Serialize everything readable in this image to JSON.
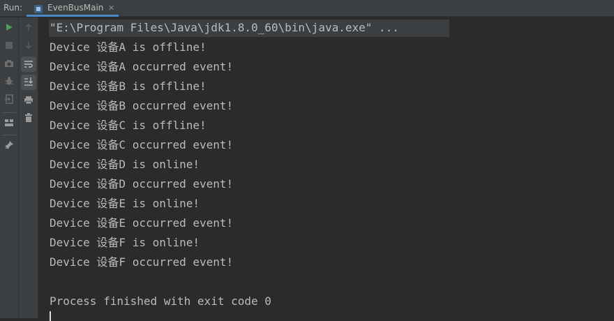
{
  "header": {
    "run_label": "Run:",
    "tab_label": "EvenBusMain",
    "tab_close": "✕"
  },
  "toolbar": {
    "left": [
      "run-icon",
      "stop-icon",
      "camera-icon",
      "debug-icon",
      "exit-icon",
      "layout-icon",
      "pin-icon"
    ],
    "right": [
      "up-arrow-icon",
      "down-arrow-icon",
      "soft-wrap-icon",
      "scroll-to-end-icon",
      "print-icon",
      "trash-icon"
    ]
  },
  "console": {
    "command": "\"E:\\Program Files\\Java\\jdk1.8.0_60\\bin\\java.exe\" ...",
    "lines": [
      "Device 设备A is offline!",
      "Device 设备A occurred event!",
      "Device 设备B is offline!",
      "Device 设备B occurred event!",
      "Device 设备C is offline!",
      "Device 设备C occurred event!",
      "Device 设备D is online!",
      "Device 设备D occurred event!",
      "Device 设备E is online!",
      "Device 设备E occurred event!",
      "Device 设备F is online!",
      "Device 设备F occurred event!"
    ],
    "exit_message": "Process finished with exit code 0"
  },
  "colors": {
    "background": "#2b2b2b",
    "panel": "#3c3f41",
    "text": "#bbbbbb",
    "run_green": "#499c54",
    "tab_accent": "#4a88c7"
  }
}
